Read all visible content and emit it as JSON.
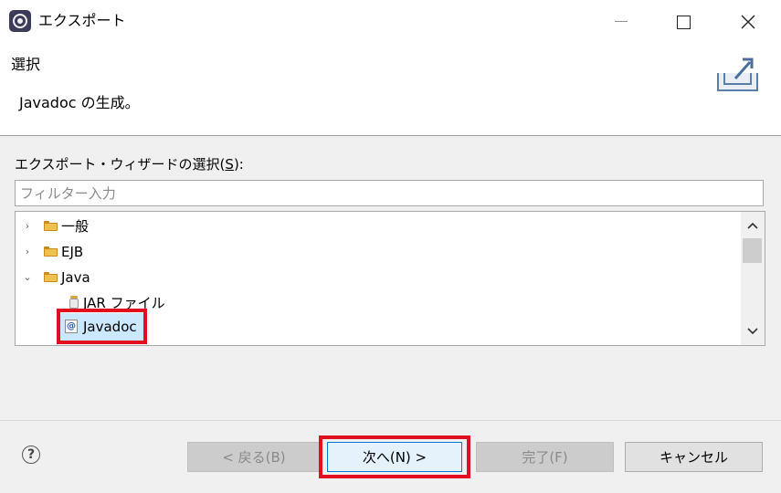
{
  "window": {
    "title": "エクスポート"
  },
  "header": {
    "title": "選択",
    "description": "Javadoc の生成。"
  },
  "wizard": {
    "label": "エクスポート・ウィザードの選択(",
    "label_mnemonic": "S",
    "label_end": "):",
    "filter_placeholder": "フィルター入力",
    "filter_value": ""
  },
  "tree": {
    "items": [
      {
        "label": "一般",
        "expanded": false,
        "icon": "folder-icon"
      },
      {
        "label": "EJB",
        "expanded": false,
        "icon": "folder-icon"
      },
      {
        "label": "Java",
        "expanded": true,
        "icon": "folder-icon"
      },
      {
        "label": "JAR ファイル",
        "icon": "jar-file-icon"
      },
      {
        "label": "Javadoc",
        "icon": "javadoc-icon",
        "selected": true
      }
    ]
  },
  "buttons": {
    "back": "< 戻る(B)",
    "next": "次へ(N) >",
    "finish": "完了(F)",
    "cancel": "キャンセル"
  },
  "help": {
    "symbol": "?"
  },
  "colors": {
    "highlight": "#e01020",
    "selection": "#cce8ff",
    "accent": "#0078d7"
  }
}
